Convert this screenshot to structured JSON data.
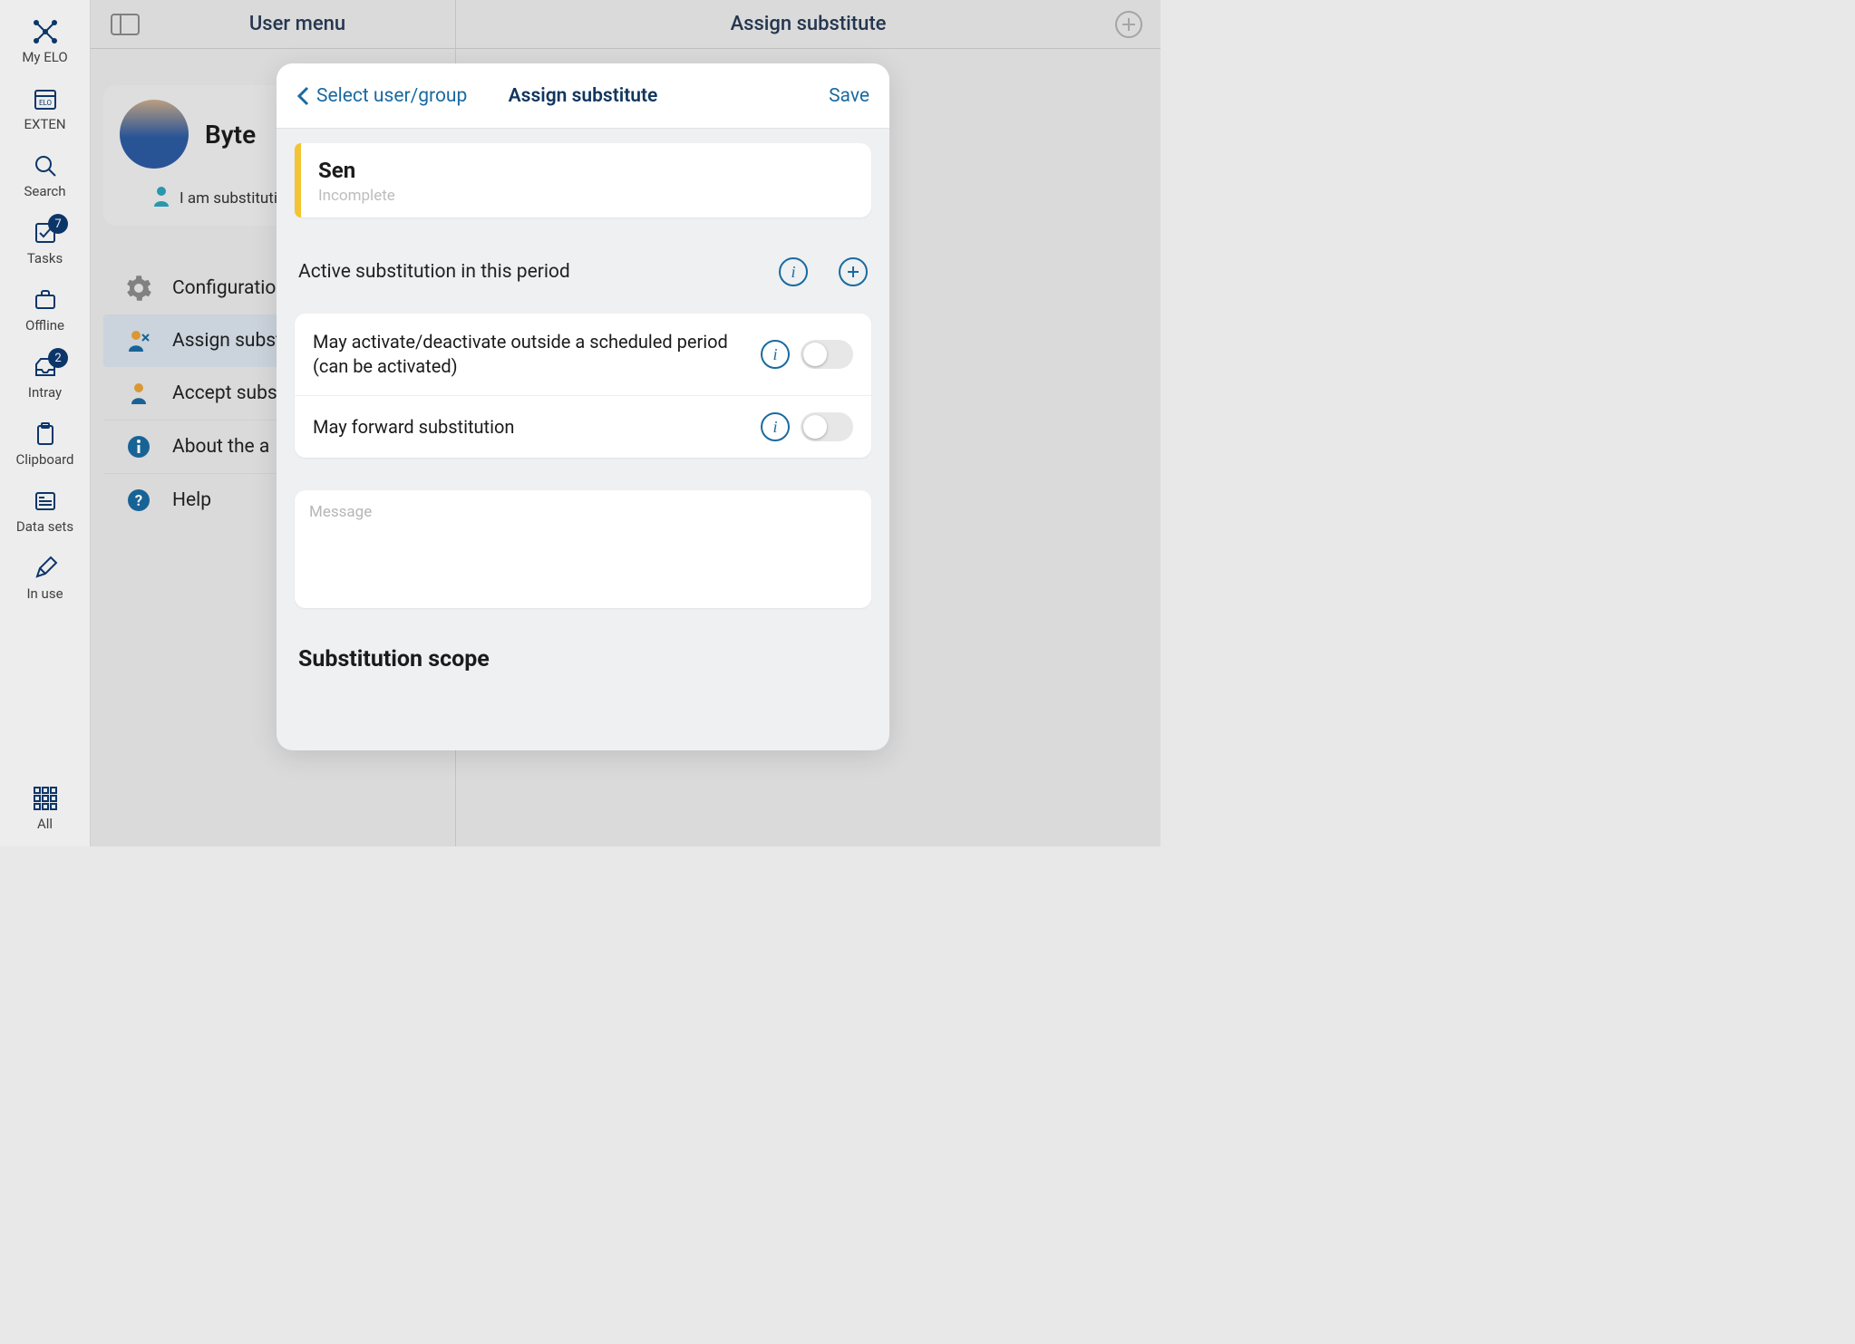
{
  "nav": {
    "items": [
      {
        "label": "My ELO"
      },
      {
        "label": "EXTEN"
      },
      {
        "label": "Search"
      },
      {
        "label": "Tasks",
        "badge": "7"
      },
      {
        "label": "Offline"
      },
      {
        "label": "Intray",
        "badge": "2"
      },
      {
        "label": "Clipboard"
      },
      {
        "label": "Data sets"
      },
      {
        "label": "In use"
      }
    ],
    "bottom_label": "All"
  },
  "header": {
    "left_title": "User menu",
    "right_title": "Assign substitute"
  },
  "user": {
    "name": "Byte",
    "substituting_prefix": "I am substituti"
  },
  "menu": {
    "configuration": "Configuratio",
    "assign_substitute": "Assign subst",
    "accept_substitute": "Accept subs",
    "about": "About the a",
    "help": "Help"
  },
  "modal": {
    "back_label": "Select user/group",
    "title": "Assign substitute",
    "save_label": "Save",
    "selected_name": "Sen",
    "selected_status": "Incomplete",
    "active_period_label": "Active substitution in this period",
    "toggle1": "May activate/deactivate outside a scheduled period (can be activated)",
    "toggle2": "May forward substitution",
    "message_placeholder": "Message",
    "scope_heading": "Substitution scope"
  }
}
